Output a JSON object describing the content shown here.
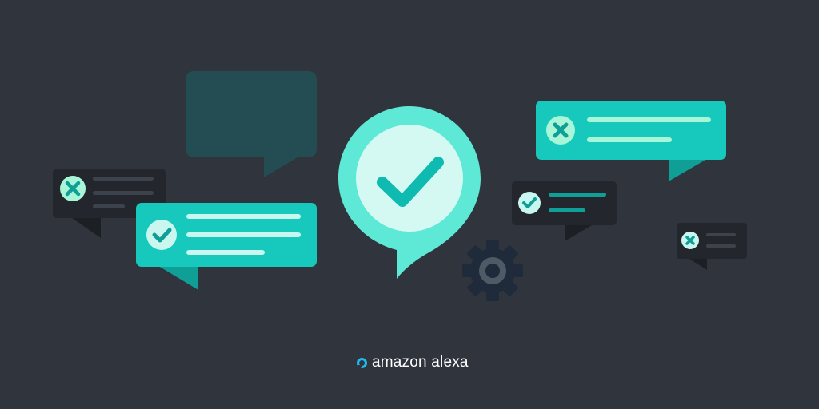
{
  "brand": {
    "text": "amazon alexa",
    "logo_icon": "alexa-ring-icon",
    "logo_color": "#20b9f0"
  },
  "colors": {
    "background": "#2f343d",
    "teal": "#16c9bc",
    "teal_dark": "#0f9f96",
    "mint": "#c9f7ef",
    "mint_text": "#a8f5d8",
    "card_dark": "#23272d",
    "card_muted": "#234c53",
    "gear": "#1f2a3a",
    "gear_hub": "#4f5a67"
  },
  "icons": {
    "success": "check-circle-icon",
    "error": "x-circle-icon",
    "settings": "gear-icon",
    "main": "speech-bubble-check-icon"
  }
}
